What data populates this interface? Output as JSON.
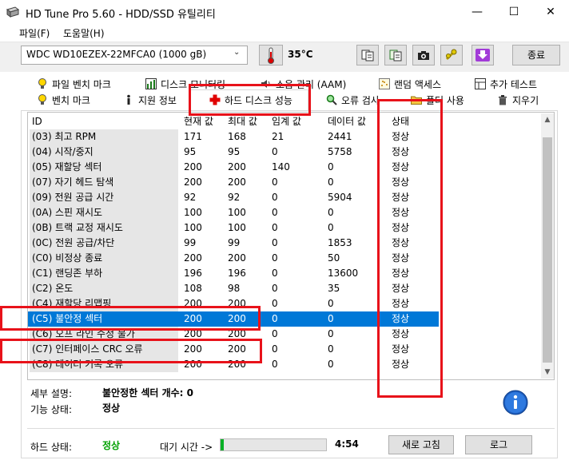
{
  "window": {
    "title": "HD Tune Pro 5.60 - HDD/SSD  유틸리티",
    "minimize": "—",
    "maximize": "☐",
    "close": "✕"
  },
  "menu": {
    "file": "파일(F)",
    "help": "도움말(H)"
  },
  "toolbar": {
    "drive": "WDC WD10EZEX-22MFCA0 (1000 gB)",
    "temperature": "35°C",
    "exit_label": "종료"
  },
  "tabs": {
    "row1": [
      "파일 벤치 마크",
      "디스크 모니터링",
      "소음 관리 (AAM)",
      "랜덤 액세스",
      "추가 테스트"
    ],
    "row2": [
      "벤치 마크",
      "지원 정보",
      "하드 디스크 성능",
      "오류 검사",
      "폴더 사용",
      "지우기"
    ],
    "active": "하드 디스크 성능"
  },
  "table": {
    "headers": [
      "ID",
      "현재 값",
      "최대 값",
      "임계 값",
      "데이터 값",
      "상태"
    ],
    "rows": [
      [
        "(03) 최고 RPM",
        "171",
        "168",
        "21",
        "2441",
        "정상"
      ],
      [
        "(04) 시작/중지",
        "95",
        "95",
        "0",
        "5758",
        "정상"
      ],
      [
        "(05) 재할당 섹터",
        "200",
        "200",
        "140",
        "0",
        "정상"
      ],
      [
        "(07) 자기 헤드 탐색",
        "200",
        "200",
        "0",
        "0",
        "정상"
      ],
      [
        "(09) 전원 공급 시간",
        "92",
        "92",
        "0",
        "5904",
        "정상"
      ],
      [
        "(0A) 스핀 재시도",
        "100",
        "100",
        "0",
        "0",
        "정상"
      ],
      [
        "(0B) 트랙 교정 재시도",
        "100",
        "100",
        "0",
        "0",
        "정상"
      ],
      [
        "(0C) 전원 공급/차단",
        "99",
        "99",
        "0",
        "1853",
        "정상"
      ],
      [
        "(C0) 비정상 종료",
        "200",
        "200",
        "0",
        "50",
        "정상"
      ],
      [
        "(C1) 랜딩존 부하",
        "196",
        "196",
        "0",
        "13600",
        "정상"
      ],
      [
        "(C2) 온도",
        "108",
        "98",
        "0",
        "35",
        "정상"
      ],
      [
        "(C4) 재할당 리맵핑",
        "200",
        "200",
        "0",
        "0",
        "정상"
      ],
      [
        "(C5) 불안정 섹터",
        "200",
        "200",
        "0",
        "0",
        "정상"
      ],
      [
        "(C6) 오프 라인 수정 불가",
        "200",
        "200",
        "0",
        "0",
        "정상"
      ],
      [
        "(C7) 인터페이스 CRC 오류",
        "200",
        "200",
        "0",
        "0",
        "정상"
      ],
      [
        "(C8) 데이터 기록 오류",
        "200",
        "200",
        "0",
        "0",
        "정상"
      ]
    ],
    "selected_row_index": 12
  },
  "details": {
    "detail_label": "세부 설명:",
    "detail_value": "불안정한 섹터 개수: 0",
    "feature_label": "기능 상태:",
    "feature_value": "정상"
  },
  "footer": {
    "health_label": "하드 상태:",
    "health_value": "정상",
    "wait_label": "대기 시간 ->",
    "progress_fraction": 0.03,
    "time": "4:54",
    "refresh_label": "새로 고침",
    "log_label": "로그"
  },
  "colors": {
    "selection": "#0078d7",
    "healthy_green": "#00a000",
    "annotation_red": "#e8121a",
    "progress_green": "#06b025"
  }
}
